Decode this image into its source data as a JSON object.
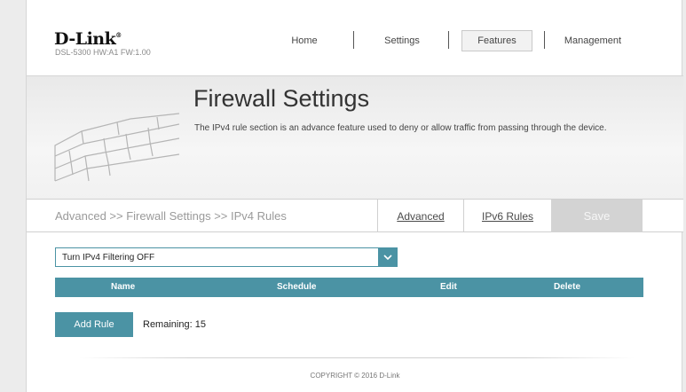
{
  "brand": {
    "logo": "D-Link",
    "model_info": "DSL-5300 HW:A1 FW:1.00"
  },
  "nav": {
    "home": "Home",
    "settings": "Settings",
    "features": "Features",
    "management": "Management"
  },
  "banner": {
    "title": "Firewall Settings",
    "description": "The IPv4 rule section is an advance feature used to deny or allow traffic from passing through the device."
  },
  "breadcrumb": "Advanced >> Firewall Settings >> IPv4 Rules",
  "tabs": {
    "advanced": "Advanced",
    "ipv6": "IPv6 Rules",
    "save": "Save"
  },
  "filter": {
    "value": "Turn IPv4 Filtering OFF"
  },
  "table": {
    "columns": [
      "Name",
      "Schedule",
      "Edit",
      "Delete"
    ]
  },
  "add_rule": {
    "label": "Add Rule",
    "remaining": "Remaining: 15"
  },
  "footer": {
    "copyright": "COPYRIGHT © 2016 D-Link"
  },
  "colors": {
    "accent": "#4b93a4",
    "save_disabled": "#d3d3d3"
  },
  "icons": {
    "brick_wall": "brick-wall-icon",
    "dropdown": "chevron-down-icon"
  }
}
